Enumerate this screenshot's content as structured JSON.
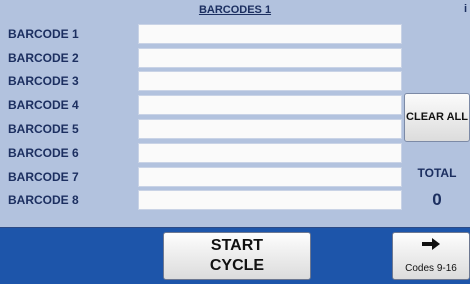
{
  "header": {
    "title": "BARCODES 1",
    "corner_mark": "i"
  },
  "barcodes": [
    {
      "label": "BARCODE 1",
      "value": ""
    },
    {
      "label": "BARCODE 2",
      "value": ""
    },
    {
      "label": "BARCODE 3",
      "value": ""
    },
    {
      "label": "BARCODE 4",
      "value": ""
    },
    {
      "label": "BARCODE 5",
      "value": ""
    },
    {
      "label": "BARCODE 6",
      "value": ""
    },
    {
      "label": "BARCODE 7",
      "value": ""
    },
    {
      "label": "BARCODE 8",
      "value": ""
    }
  ],
  "buttons": {
    "clear_all": "CLEAR ALL",
    "start_line1": "START",
    "start_line2": "CYCLE",
    "next_icon": "right-arrow-icon",
    "next_label": "Codes 9-16"
  },
  "total": {
    "label": "TOTAL",
    "value": "0"
  },
  "colors": {
    "background": "#b2c2de",
    "text": "#1c2f60",
    "bottom_bar": "#1d55aa",
    "field": "#fafafa"
  }
}
